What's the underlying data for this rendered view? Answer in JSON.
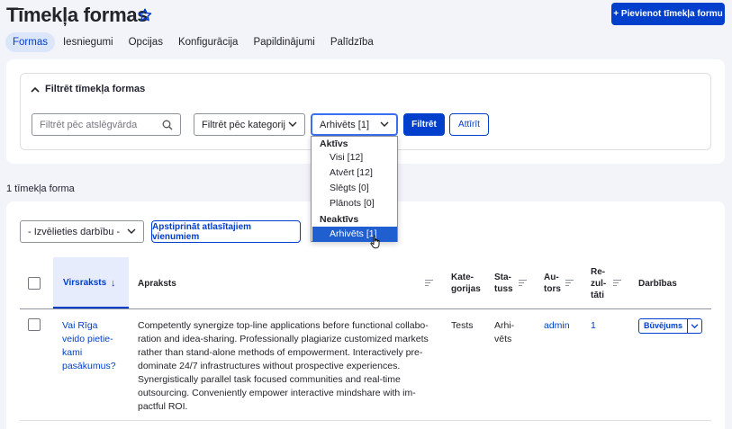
{
  "page": {
    "title": "Tīmekļa formas",
    "add_button": "+ Pievienot tīmekļa formu"
  },
  "tabs": [
    {
      "label": "Formas",
      "active": true
    },
    {
      "label": "Iesniegumi"
    },
    {
      "label": "Opcijas"
    },
    {
      "label": "Konfigurācija"
    },
    {
      "label": "Papildinājumi"
    },
    {
      "label": "Palīdzība"
    }
  ],
  "filter": {
    "heading": "Filtrēt tīmekļa formas",
    "search_placeholder": "Filtrēt pēc atslēgvārda",
    "category_select": "Filtrēt pēc kategorij",
    "state_select": "Arhivēts [1]",
    "filter_button": "Filtrēt",
    "reset_button": "Attīrīt",
    "dropdown": {
      "group_active": "Aktīvs",
      "group_inactive": "Neaktīvs",
      "items": [
        "Visi [12]",
        "Atvērt [12]",
        "Slēgts [0]",
        "Plānots [0]",
        "Arhivēts [1]"
      ],
      "selected": "Arhivēts [1]"
    }
  },
  "results_count": "1 tīmekļa forma",
  "bulk": {
    "select_label": "- Izvēlieties darbību -",
    "apply_button": "Apstiprināt atlasītajiem vienumiem"
  },
  "table": {
    "headers": {
      "title": "Virsraksts",
      "description": "Apraksts",
      "category": [
        "Kate-",
        "gorijas"
      ],
      "status": [
        "Sta-",
        "tuss"
      ],
      "author": [
        "Au-",
        "tors"
      ],
      "results": [
        "Re-",
        "zul-",
        "tāti"
      ],
      "actions": "Darbības"
    },
    "row": {
      "title_lines": [
        "Vai Rīga",
        "veido pietie-",
        "kami",
        "pasākumus?"
      ],
      "description_lines": [
        "Competently synergize top-line applications before functional collabo-",
        "ration and idea-sharing. Professionally plagiarize customized markets",
        "rather than stand-alone methods of empowerment. Interactively pre-",
        "dominate 24/7 infrastructures without prospective experiences.",
        "Synergistically parallel task focused communities and real-time",
        "outsourcing. Conveniently empower interactive mindshare with im-",
        "pactful ROI."
      ],
      "category": "Tests",
      "status_lines": [
        "Arhi-",
        "vēts"
      ],
      "author": "admin",
      "results": "1",
      "action_button": "Būvējums"
    }
  },
  "colors": {
    "accent": "#003ecc",
    "selected_option": "#1f5fcf"
  }
}
